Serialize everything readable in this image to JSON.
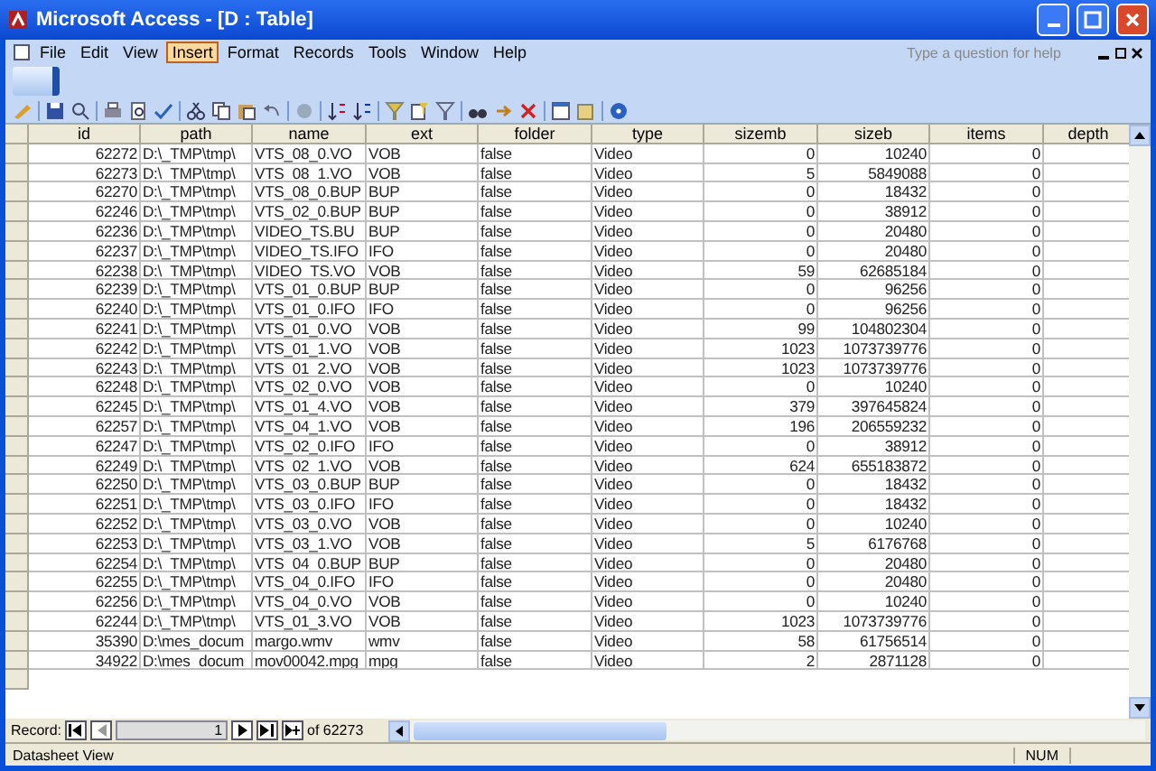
{
  "window": {
    "title": "Microsoft Access - [D : Table]"
  },
  "menu": [
    {
      "label": "File",
      "selected": false
    },
    {
      "label": "Edit",
      "selected": false
    },
    {
      "label": "View",
      "selected": false
    },
    {
      "label": "Insert",
      "selected": true
    },
    {
      "label": "Format",
      "selected": false
    },
    {
      "label": "Records",
      "selected": false
    },
    {
      "label": "Tools",
      "selected": false
    },
    {
      "label": "Window",
      "selected": false
    },
    {
      "label": "Help",
      "selected": false
    }
  ],
  "help_search": {
    "placeholder": "Type a question for help"
  },
  "table": {
    "columns": [
      "id",
      "path",
      "name",
      "ext",
      "folder",
      "type",
      "sizemb",
      "sizeb",
      "items",
      "depth"
    ],
    "rows": [
      [
        "62272",
        "D:\\_TMP\\tmp\\",
        "VTS_08_0.VO",
        "VOB",
        "false",
        "Video",
        "0",
        "10240",
        "0"
      ],
      [
        "62273",
        "D:\\_TMP\\tmp\\",
        "VTS_08_1.VO",
        "VOB",
        "false",
        "Video",
        "5",
        "5849088",
        "0"
      ],
      [
        "62270",
        "D:\\_TMP\\tmp\\",
        "VTS_08_0.BUP",
        "BUP",
        "false",
        "Video",
        "0",
        "18432",
        "0"
      ],
      [
        "62246",
        "D:\\_TMP\\tmp\\",
        "VTS_02_0.BUP",
        "BUP",
        "false",
        "Video",
        "0",
        "38912",
        "0"
      ],
      [
        "62236",
        "D:\\_TMP\\tmp\\",
        "VIDEO_TS.BU",
        "BUP",
        "false",
        "Video",
        "0",
        "20480",
        "0"
      ],
      [
        "62237",
        "D:\\_TMP\\tmp\\",
        "VIDEO_TS.IFO",
        "IFO",
        "false",
        "Video",
        "0",
        "20480",
        "0"
      ],
      [
        "62238",
        "D:\\_TMP\\tmp\\",
        "VIDEO_TS.VO",
        "VOB",
        "false",
        "Video",
        "59",
        "62685184",
        "0"
      ],
      [
        "62239",
        "D:\\_TMP\\tmp\\",
        "VTS_01_0.BUP",
        "BUP",
        "false",
        "Video",
        "0",
        "96256",
        "0"
      ],
      [
        "62240",
        "D:\\_TMP\\tmp\\",
        "VTS_01_0.IFO",
        "IFO",
        "false",
        "Video",
        "0",
        "96256",
        "0"
      ],
      [
        "62241",
        "D:\\_TMP\\tmp\\",
        "VTS_01_0.VO",
        "VOB",
        "false",
        "Video",
        "99",
        "104802304",
        "0"
      ],
      [
        "62242",
        "D:\\_TMP\\tmp\\",
        "VTS_01_1.VO",
        "VOB",
        "false",
        "Video",
        "1023",
        "1073739776",
        "0"
      ],
      [
        "62243",
        "D:\\_TMP\\tmp\\",
        "VTS_01_2.VO",
        "VOB",
        "false",
        "Video",
        "1023",
        "1073739776",
        "0"
      ],
      [
        "62248",
        "D:\\_TMP\\tmp\\",
        "VTS_02_0.VO",
        "VOB",
        "false",
        "Video",
        "0",
        "10240",
        "0"
      ],
      [
        "62245",
        "D:\\_TMP\\tmp\\",
        "VTS_01_4.VO",
        "VOB",
        "false",
        "Video",
        "379",
        "397645824",
        "0"
      ],
      [
        "62257",
        "D:\\_TMP\\tmp\\",
        "VTS_04_1.VO",
        "VOB",
        "false",
        "Video",
        "196",
        "206559232",
        "0"
      ],
      [
        "62247",
        "D:\\_TMP\\tmp\\",
        "VTS_02_0.IFO",
        "IFO",
        "false",
        "Video",
        "0",
        "38912",
        "0"
      ],
      [
        "62249",
        "D:\\_TMP\\tmp\\",
        "VTS_02_1.VO",
        "VOB",
        "false",
        "Video",
        "624",
        "655183872",
        "0"
      ],
      [
        "62250",
        "D:\\_TMP\\tmp\\",
        "VTS_03_0.BUP",
        "BUP",
        "false",
        "Video",
        "0",
        "18432",
        "0"
      ],
      [
        "62251",
        "D:\\_TMP\\tmp\\",
        "VTS_03_0.IFO",
        "IFO",
        "false",
        "Video",
        "0",
        "18432",
        "0"
      ],
      [
        "62252",
        "D:\\_TMP\\tmp\\",
        "VTS_03_0.VO",
        "VOB",
        "false",
        "Video",
        "0",
        "10240",
        "0"
      ],
      [
        "62253",
        "D:\\_TMP\\tmp\\",
        "VTS_03_1.VO",
        "VOB",
        "false",
        "Video",
        "5",
        "6176768",
        "0"
      ],
      [
        "62254",
        "D:\\_TMP\\tmp\\",
        "VTS_04_0.BUP",
        "BUP",
        "false",
        "Video",
        "0",
        "20480",
        "0"
      ],
      [
        "62255",
        "D:\\_TMP\\tmp\\",
        "VTS_04_0.IFO",
        "IFO",
        "false",
        "Video",
        "0",
        "20480",
        "0"
      ],
      [
        "62256",
        "D:\\_TMP\\tmp\\",
        "VTS_04_0.VO",
        "VOB",
        "false",
        "Video",
        "0",
        "10240",
        "0"
      ],
      [
        "62244",
        "D:\\_TMP\\tmp\\",
        "VTS_01_3.VO",
        "VOB",
        "false",
        "Video",
        "1023",
        "1073739776",
        "0"
      ],
      [
        "35390",
        "D:\\mes_docum",
        "margo.wmv",
        "wmv",
        "false",
        "Video",
        "58",
        "61756514",
        "0"
      ],
      [
        "34922",
        "D:\\mes_docum",
        "mov00042.mpg",
        "mpg",
        "false",
        "Video",
        "2",
        "2871128",
        "0"
      ]
    ]
  },
  "navigation": {
    "label": "Record:",
    "current": "1",
    "total": "of 62273"
  },
  "status_bar": {
    "view": "Datasheet View",
    "indicator": "NUM"
  }
}
